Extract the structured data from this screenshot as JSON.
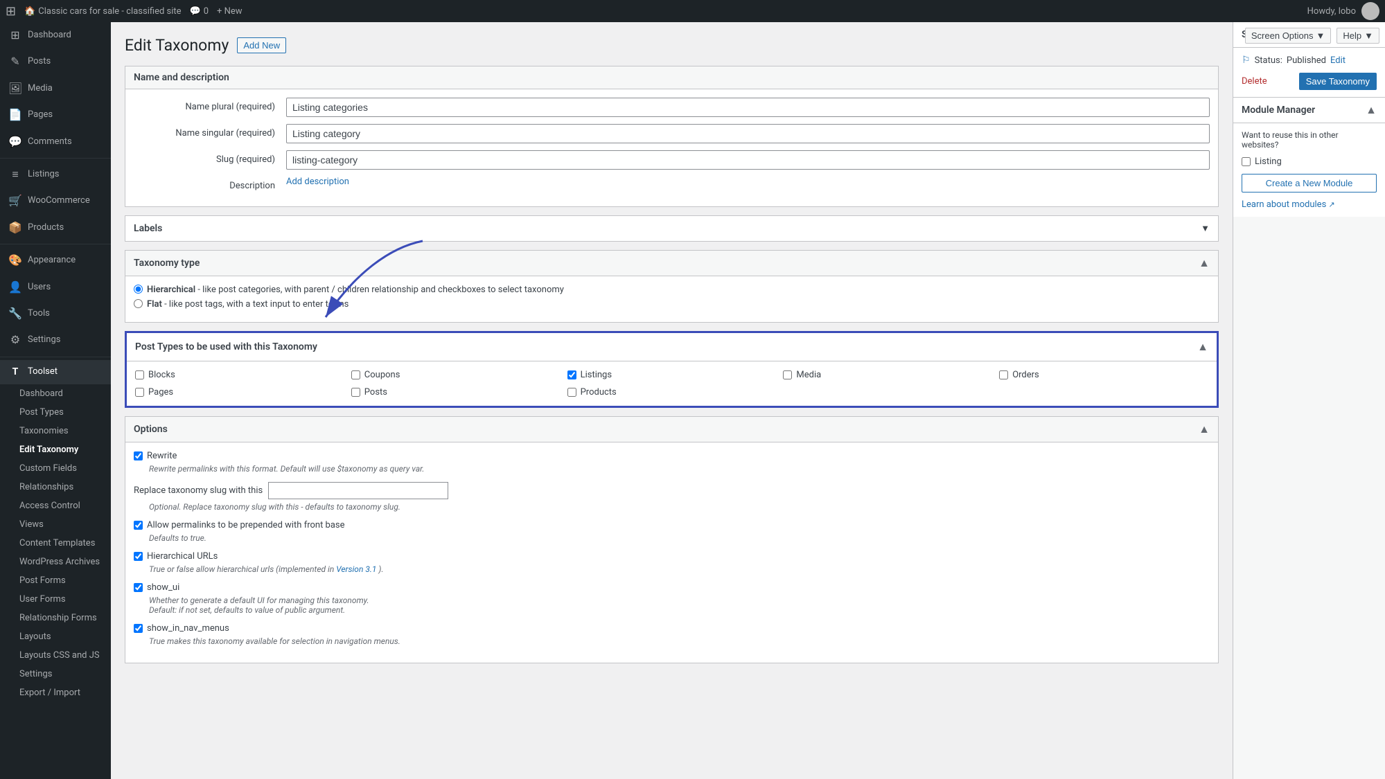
{
  "adminBar": {
    "logo": "W",
    "siteName": "Classic cars for sale - classified site",
    "comments": "0",
    "newLabel": "+ New",
    "howdyLabel": "Howdy, lobo"
  },
  "screenOptions": {
    "label": "Screen Options",
    "arrow": "▼"
  },
  "helpBtn": {
    "label": "Help",
    "arrow": "▼"
  },
  "sidebar": {
    "items": [
      {
        "id": "dashboard",
        "icon": "⊞",
        "label": "Dashboard"
      },
      {
        "id": "posts",
        "icon": "✎",
        "label": "Posts"
      },
      {
        "id": "media",
        "icon": "🖼",
        "label": "Media"
      },
      {
        "id": "pages",
        "icon": "📄",
        "label": "Pages"
      },
      {
        "id": "comments",
        "icon": "💬",
        "label": "Comments"
      },
      {
        "id": "listings",
        "icon": "≡",
        "label": "Listings"
      },
      {
        "id": "woocommerce",
        "icon": "🛒",
        "label": "WooCommerce"
      },
      {
        "id": "products",
        "icon": "📦",
        "label": "Products"
      },
      {
        "id": "appearance",
        "icon": "🎨",
        "label": "Appearance"
      },
      {
        "id": "users",
        "icon": "👤",
        "label": "Users"
      },
      {
        "id": "tools",
        "icon": "🔧",
        "label": "Tools"
      },
      {
        "id": "settings",
        "icon": "⚙",
        "label": "Settings"
      },
      {
        "id": "toolset",
        "icon": "T",
        "label": "Toolset"
      }
    ],
    "toolsetSubItems": [
      {
        "id": "ts-dashboard",
        "label": "Dashboard"
      },
      {
        "id": "ts-post-types",
        "label": "Post Types"
      },
      {
        "id": "ts-taxonomies",
        "label": "Taxonomies"
      },
      {
        "id": "ts-edit-taxonomy",
        "label": "Edit Taxonomy",
        "active": true
      },
      {
        "id": "ts-custom-fields",
        "label": "Custom Fields"
      },
      {
        "id": "ts-relationships",
        "label": "Relationships"
      },
      {
        "id": "ts-access-control",
        "label": "Access Control"
      },
      {
        "id": "ts-views",
        "label": "Views"
      },
      {
        "id": "ts-content-templates",
        "label": "Content Templates"
      },
      {
        "id": "ts-wordpress-archives",
        "label": "WordPress Archives"
      },
      {
        "id": "ts-post-forms",
        "label": "Post Forms"
      },
      {
        "id": "ts-user-forms",
        "label": "User Forms"
      },
      {
        "id": "ts-relationship-forms",
        "label": "Relationship Forms"
      },
      {
        "id": "ts-layouts",
        "label": "Layouts"
      },
      {
        "id": "ts-layouts-css-js",
        "label": "Layouts CSS and JS"
      },
      {
        "id": "ts-settings",
        "label": "Settings"
      },
      {
        "id": "ts-export-import",
        "label": "Export / Import"
      }
    ]
  },
  "pageHeader": {
    "title": "Edit Taxonomy",
    "addNewLabel": "Add New"
  },
  "nameDescriptionPanel": {
    "title": "Name and description",
    "namePluralLabel": "Name plural (required)",
    "namePluralValue": "Listing categories",
    "nameSingularLabel": "Name singular (required)",
    "nameSingularValue": "Listing category",
    "slugLabel": "Slug (required)",
    "slugValue": "listing-category",
    "descriptionLabel": "Description",
    "addDescriptionLabel": "Add description"
  },
  "labelsPanel": {
    "title": "Labels",
    "collapseIcon": "▼"
  },
  "taxonomyTypePanel": {
    "title": "Taxonomy type",
    "collapseIcon": "▲",
    "hierarchicalLabel": "Hierarchical",
    "hierarchicalDesc": " - like post categories, with parent / children relationship and checkboxes to select taxonomy",
    "flatLabel": "Flat",
    "flatDesc": " - like post tags, with a text input to enter terms"
  },
  "postTypesPanel": {
    "title": "Post Types to be used with this Taxonomy",
    "collapseIcon": "▲",
    "checkboxes": [
      {
        "id": "pt-blocks",
        "label": "Blocks",
        "checked": false
      },
      {
        "id": "pt-coupons",
        "label": "Coupons",
        "checked": false
      },
      {
        "id": "pt-listings",
        "label": "Listings",
        "checked": true
      },
      {
        "id": "pt-media",
        "label": "Media",
        "checked": false
      },
      {
        "id": "pt-orders",
        "label": "Orders",
        "checked": false
      },
      {
        "id": "pt-pages",
        "label": "Pages",
        "checked": false
      },
      {
        "id": "pt-posts",
        "label": "Posts",
        "checked": false
      },
      {
        "id": "pt-products",
        "label": "Products",
        "checked": false
      }
    ]
  },
  "optionsPanel": {
    "title": "Options",
    "collapseIcon": "▲",
    "rewriteLabel": "Rewrite",
    "rewriteChecked": true,
    "rewriteDesc": "Rewrite permalinks with this format. Default will use $taxonomy as query var.",
    "replaceTaxonomySlugLabel": "Replace taxonomy slug with this",
    "replaceTaxonomySlugDesc": "Optional. Replace taxonomy slug with this - defaults to taxonomy slug.",
    "allowPermalinksLabel": "Allow permalinks to be prepended with front base",
    "allowPermalinksChecked": true,
    "allowPermalinksDesc": "Defaults to true.",
    "hierarchicalURLsLabel": "Hierarchical URLs",
    "hierarchicalURLsChecked": true,
    "hierarchicalURLsDesc": "True or false allow hierarchical urls (implemented in ",
    "hierarchicalURLsLinkText": "Version 3.1",
    "hierarchicalURLsDescEnd": ").",
    "showUiLabel": "show_ui",
    "showUiChecked": true,
    "showUiDesc": "Whether to generate a default UI for managing this taxonomy.",
    "showUiDesc2": "Default: if not set, defaults to value of public argument.",
    "showInNavMenusLabel": "show_in_nav_menus",
    "showInNavMenusChecked": true,
    "showInNavMenusDesc": "True makes this taxonomy available for selection in navigation menus."
  },
  "saveBox": {
    "title": "Save",
    "collapseIcon": "▲",
    "statusLabel": "Status:",
    "statusValue": "Published",
    "editLabel": "Edit",
    "deleteLabel": "Delete",
    "saveTaxonomyLabel": "Save Taxonomy"
  },
  "moduleManager": {
    "title": "Module Manager",
    "collapseIcon": "▲",
    "descLabel": "Want to reuse this in other websites?",
    "listingLabel": "Listing",
    "listingChecked": false,
    "createNewModuleLabel": "Create a New Module",
    "learnAboutModulesLabel": "Learn about modules"
  }
}
